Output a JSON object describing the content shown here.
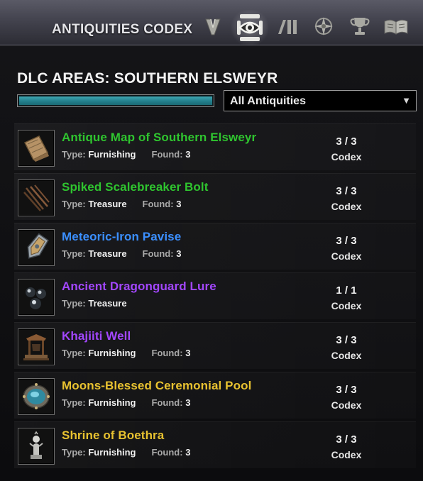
{
  "header": {
    "title": "ANTIQUITIES CODEX",
    "tabs": [
      {
        "name": "scrying-tab",
        "icon": "scrying-v-icon",
        "active": false
      },
      {
        "name": "codex-tab",
        "icon": "codex-eye-icon",
        "active": true
      },
      {
        "name": "progress-tab",
        "icon": "bars-icon",
        "active": false
      },
      {
        "name": "skills-tab",
        "icon": "compass-star-icon",
        "active": false
      },
      {
        "name": "achievements-tab",
        "icon": "trophy-icon",
        "active": false
      },
      {
        "name": "lore-tab",
        "icon": "open-book-icon",
        "active": false
      }
    ]
  },
  "section": {
    "title": "DLC AREAS: SOUTHERN ELSWEYR",
    "progress": 1.0
  },
  "filter": {
    "selected": "All Antiquities",
    "arrow": "▼"
  },
  "labels": {
    "type": "Type:",
    "found": "Found:",
    "codex": "Codex"
  },
  "items": [
    {
      "name": "Antique Map of Southern Elsweyr",
      "color": "#2fc42f",
      "type": "Furnishing",
      "found": "3",
      "count": "3 / 3",
      "icon": "map-icon"
    },
    {
      "name": "Spiked Scalebreaker Bolt",
      "color": "#2fc42f",
      "type": "Treasure",
      "found": "3",
      "count": "3 / 3",
      "icon": "bolts-icon"
    },
    {
      "name": "Meteoric-Iron Pavise",
      "color": "#3b8fff",
      "type": "Treasure",
      "found": "3",
      "count": "3 / 3",
      "icon": "shield-icon"
    },
    {
      "name": "Ancient Dragonguard Lure",
      "color": "#a347ff",
      "type": "Treasure",
      "found": "",
      "count": "1 / 1",
      "icon": "orbs-icon"
    },
    {
      "name": "Khajiiti Well",
      "color": "#a347ff",
      "type": "Furnishing",
      "found": "3",
      "count": "3 / 3",
      "icon": "well-icon"
    },
    {
      "name": "Moons-Blessed Ceremonial Pool",
      "color": "#e8c230",
      "type": "Furnishing",
      "found": "3",
      "count": "3 / 3",
      "icon": "pool-icon"
    },
    {
      "name": "Shrine of Boethra",
      "color": "#e8c230",
      "type": "Furnishing",
      "found": "3",
      "count": "3 / 3",
      "icon": "shrine-icon"
    }
  ]
}
